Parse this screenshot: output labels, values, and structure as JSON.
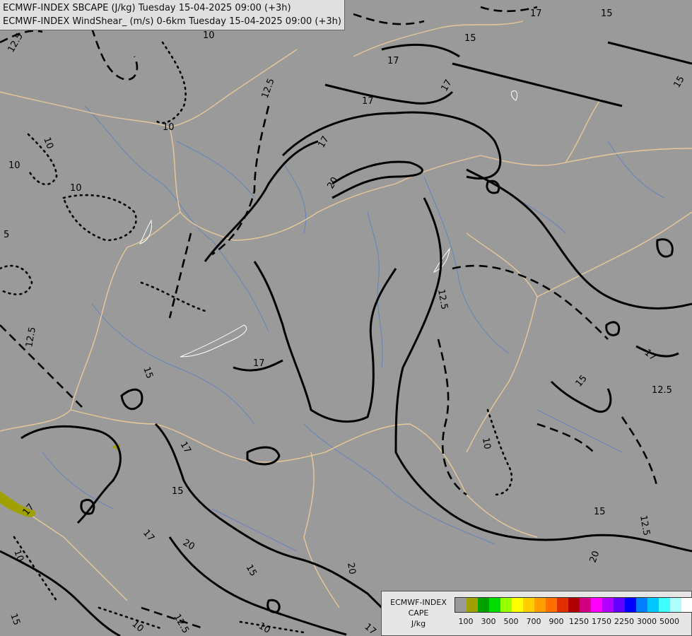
{
  "header": {
    "line1": "ECMWF-INDEX SBCAPE (J/kg) Tuesday 15-04-2025 09:00 (+3h)",
    "line2": "ECMWF-INDEX WindShear_ (m/s) 0-6km Tuesday 15-04-2025 09:00 (+3h)"
  },
  "colors": {
    "background": "#9a9a9a",
    "contour": "#000000",
    "border": "#e8c898",
    "river": "#5a7fc0",
    "lake": "#ffffff",
    "cape_low": "#a0a000"
  },
  "contour_labels": [
    "12.5",
    "10",
    "10",
    "10",
    "10",
    "5",
    "12.5",
    "17",
    "15",
    "17",
    "17",
    "15",
    "12.5",
    "17",
    "20",
    "17",
    "12.5",
    "15",
    "17",
    "15",
    "17",
    "15",
    "12.5",
    "15",
    "10",
    "15",
    "12.5",
    "20",
    "17",
    "20",
    "15",
    "12.5",
    "10",
    "20",
    "17",
    "15",
    "10",
    "12.5",
    "15"
  ],
  "legend": {
    "caption": [
      "ECMWF-INDEX",
      "CAPE",
      "J/kg"
    ],
    "colors": [
      "#9a9a9a",
      "#a0a000",
      "#00a000",
      "#00dc00",
      "#96ff00",
      "#ffff00",
      "#ffd000",
      "#ffa000",
      "#ff7000",
      "#e03000",
      "#b00000",
      "#d00080",
      "#ff00ff",
      "#b000ff",
      "#6000ff",
      "#0000ff",
      "#0080ff",
      "#00c8ff",
      "#40ffff",
      "#b0ffff",
      "#ffffff"
    ],
    "tick_labels": [
      "100",
      "300",
      "500",
      "700",
      "900",
      "1250",
      "1750",
      "2250",
      "3000",
      "5000"
    ]
  }
}
